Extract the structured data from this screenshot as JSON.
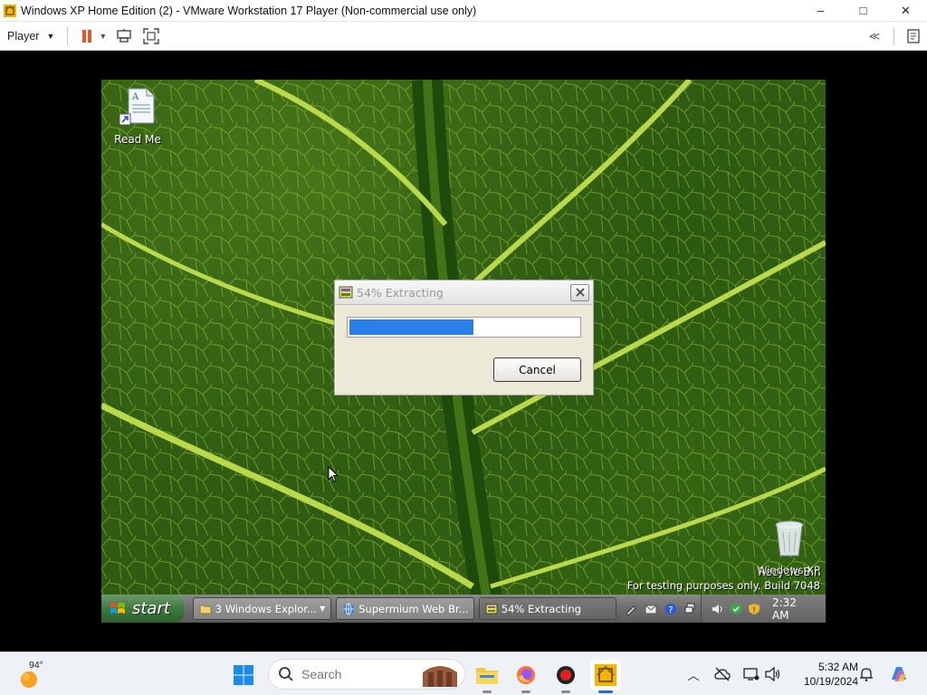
{
  "vm_window": {
    "title": "Windows XP Home Edition (2) - VMware Workstation 17 Player (Non-commercial use only)",
    "minimize": "–",
    "maximize": "□",
    "close": "✕"
  },
  "toolbar": {
    "player_menu": "Player"
  },
  "desktop": {
    "icons": [
      {
        "label": "Read Me",
        "icon": "document-shortcut-icon"
      },
      {
        "label": "Recycle Bin",
        "icon": "recycle-bin-icon"
      }
    ],
    "watermark": {
      "line1": "Windows XP",
      "line2": "For testing purposes only. Build 7048"
    }
  },
  "dialog": {
    "title": "54% Extracting",
    "progress": 0.54,
    "cancel_label": "Cancel"
  },
  "xp_taskbar": {
    "start_label": "start",
    "tasks": [
      {
        "label": "3 Windows Explor...",
        "has_dropdown": true
      },
      {
        "label": "Supermium Web Br...",
        "has_dropdown": false
      },
      {
        "label": "54% Extracting",
        "has_dropdown": false
      }
    ],
    "clock": "2:32 AM"
  },
  "host_taskbar": {
    "weather_temp": "94°",
    "search_placeholder": "Search",
    "time": "5:32 AM",
    "date": "10/19/2024"
  },
  "colors": {
    "progress_fill": "#2a80e8",
    "xp_start": "#3e7a3e",
    "win11_accent": "#1a6fd8"
  }
}
